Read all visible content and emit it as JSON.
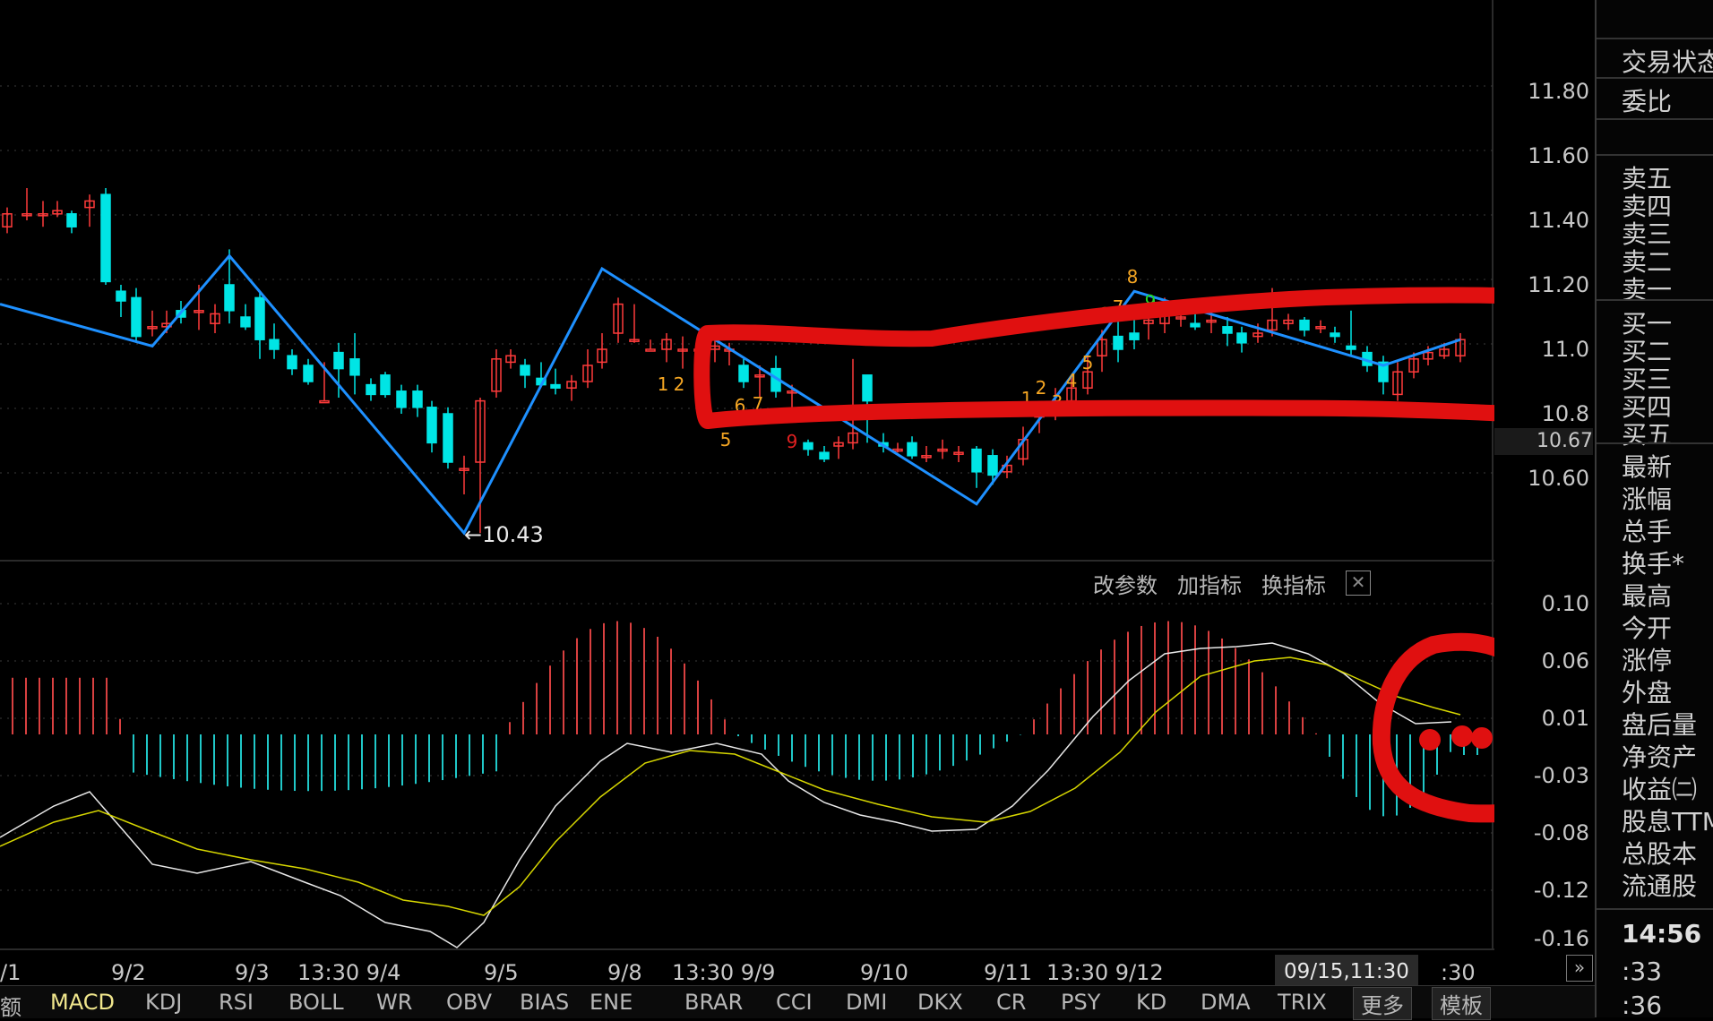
{
  "price_axis": [
    "11.80",
    "11.60",
    "11.40",
    "11.20",
    "11.0",
    "10.8",
    "10.60"
  ],
  "current_price_tag": "10.67",
  "low_marker": "←10.43",
  "macd_axis": [
    "0.10",
    "0.06",
    "0.01",
    "-0.03",
    "-0.08",
    "-0.12",
    "-0.16"
  ],
  "macd_toolbar": {
    "edit_params": "改参数",
    "add_indicator": "加指标",
    "swap_indicator": "换指标",
    "close": "✕"
  },
  "date_labels": [
    "/1",
    "9/2",
    "9/3",
    "13:30 9/4",
    "9/5",
    "9/8",
    "13:30 9/9",
    "9/10",
    "9/11",
    "13:30 9/12",
    ":30"
  ],
  "crosshair_time": "09/15,11:30",
  "td_labels": [
    {
      "t": "1",
      "c": "#f5a623"
    },
    {
      "t": "2",
      "c": "#f5a623"
    },
    {
      "t": "5",
      "c": "#f5a623"
    },
    {
      "t": "6",
      "c": "#f5a623"
    },
    {
      "t": "7",
      "c": "#f5a623"
    },
    {
      "t": "9",
      "c": "#e02020"
    },
    {
      "t": "1",
      "c": "#f5a623"
    },
    {
      "t": "2",
      "c": "#f5a623"
    },
    {
      "t": "3",
      "c": "#f5a623"
    },
    {
      "t": "4",
      "c": "#f5a623"
    },
    {
      "t": "5",
      "c": "#f5a623"
    },
    {
      "t": "6",
      "c": "#f5a623"
    },
    {
      "t": "7",
      "c": "#f5a623"
    },
    {
      "t": "8",
      "c": "#f5a623"
    },
    {
      "t": "9",
      "c": "#22dd22"
    }
  ],
  "indicator_tabs": [
    "额",
    "MACD",
    "KDJ",
    "RSI",
    "BOLL",
    "WR",
    "OBV",
    "BIAS",
    "ENE",
    "BRAR",
    "CCI",
    "DMI",
    "DKX",
    "CR",
    "PSY",
    "KD",
    "DMA",
    "TRIX",
    "更多",
    "模板"
  ],
  "active_tab": "MACD",
  "right_panel": {
    "status": "交易状态",
    "ratio": "委比",
    "sell": [
      "卖五",
      "卖四",
      "卖三",
      "卖二",
      "卖一"
    ],
    "buy": [
      "买一",
      "买二",
      "买三",
      "买四",
      "买五"
    ],
    "stats": [
      "最新",
      "涨幅",
      "总手",
      "换手*",
      "最高",
      "今开",
      "涨停",
      "外盘",
      "盘后量",
      "净资产",
      "收益㈡",
      "股息TTM",
      "总股本",
      "流通股"
    ],
    "time_main": "14:56",
    "time_rows": [
      ":33",
      ":36"
    ]
  },
  "colors": {
    "up": "#ff3b3b",
    "down": "#00e5e5",
    "zigzag": "#1e90ff",
    "annotation": "#e01010",
    "dif": "#e8e8e8",
    "dea": "#d6d600"
  }
}
